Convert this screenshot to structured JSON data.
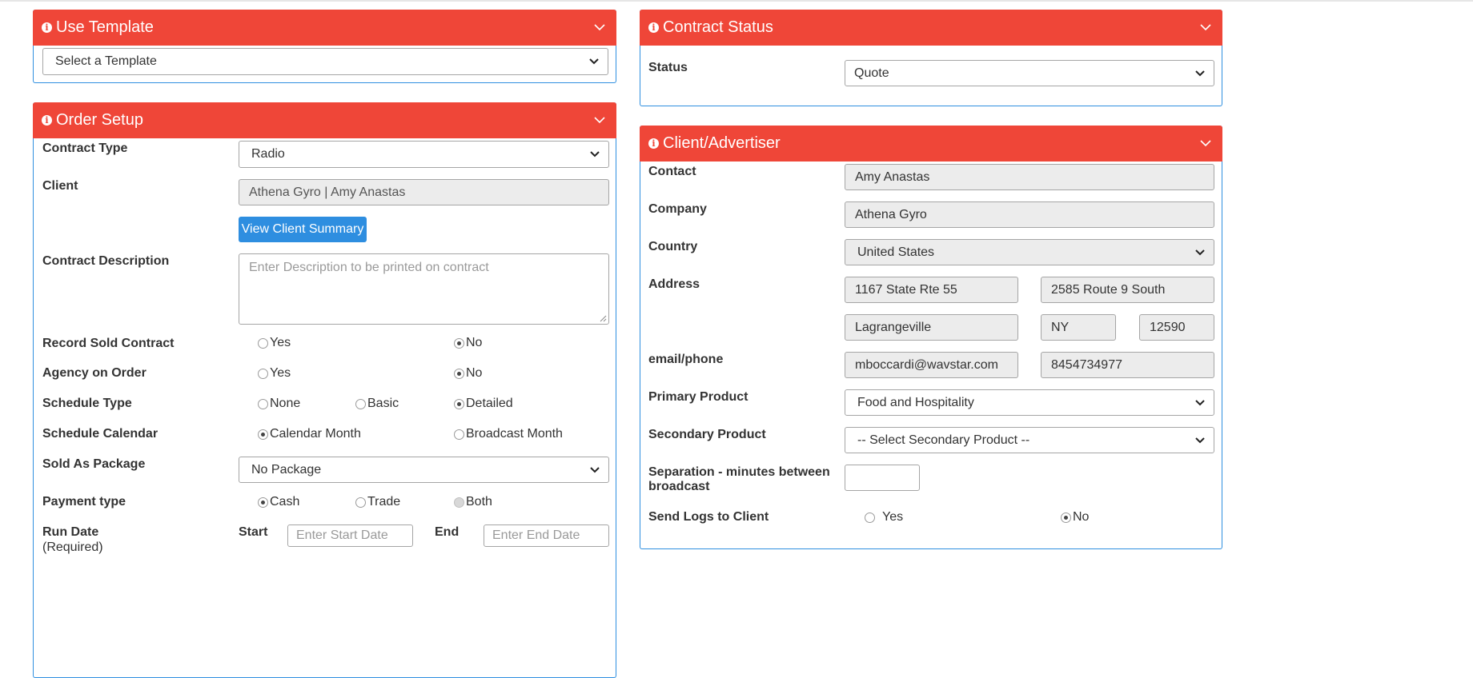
{
  "template_panel": {
    "title": "Use Template",
    "select_value": "Select a Template"
  },
  "order_setup": {
    "title": "Order Setup",
    "contract_type": {
      "label": "Contract Type",
      "value": "Radio"
    },
    "client": {
      "label": "Client",
      "value": "Athena Gyro | Amy Anastas",
      "button": "View Client Summary"
    },
    "contract_description": {
      "label": "Contract Description",
      "placeholder": "Enter Description to be printed on contract"
    },
    "record_sold_contract": {
      "label": "Record Sold Contract",
      "options": [
        "Yes",
        "No"
      ],
      "selected": "No"
    },
    "agency_on_order": {
      "label": "Agency on Order",
      "options": [
        "Yes",
        "No"
      ],
      "selected": "No"
    },
    "schedule_type": {
      "label": "Schedule Type",
      "options": [
        "None",
        "Basic",
        "Detailed"
      ],
      "selected": "Detailed"
    },
    "schedule_calendar": {
      "label": "Schedule Calendar",
      "options": [
        "Calendar Month",
        "Broadcast Month"
      ],
      "selected": "Calendar Month"
    },
    "sold_as_package": {
      "label": "Sold As Package",
      "value": "No Package"
    },
    "payment_type": {
      "label": "Payment type",
      "options": [
        "Cash",
        "Trade",
        "Both"
      ],
      "selected": "Cash",
      "disabled": "Both"
    },
    "run_date": {
      "label": "Run Date",
      "sublabel": "(Required)",
      "start_label": "Start",
      "start_placeholder": "Enter Start Date",
      "end_label": "End",
      "end_placeholder": "Enter End Date"
    }
  },
  "contract_status": {
    "title": "Contract Status",
    "status_label": "Status",
    "status_value": "Quote"
  },
  "client_advertiser": {
    "title": "Client/Advertiser",
    "contact": {
      "label": "Contact",
      "value": "Amy Anastas"
    },
    "company": {
      "label": "Company",
      "value": "Athena Gyro"
    },
    "country": {
      "label": "Country",
      "value": "United States"
    },
    "address": {
      "label": "Address",
      "line1": "1167 State Rte 55",
      "line2": "2585 Route 9 South",
      "city": "Lagrangeville",
      "state": "NY",
      "zip": "12590"
    },
    "email_phone": {
      "label": "email/phone",
      "email": "mboccardi@wavstar.com",
      "phone": "8454734977"
    },
    "primary_product": {
      "label": "Primary Product",
      "value": "Food and Hospitality"
    },
    "secondary_product": {
      "label": "Secondary Product",
      "value": "-- Select Secondary Product --"
    },
    "separation": {
      "label_line1": "Separation - minutes between",
      "label_line2": "broadcast",
      "value": ""
    },
    "send_logs": {
      "label": "Send Logs to Client",
      "options": [
        "Yes",
        "No"
      ],
      "selected": "No"
    }
  },
  "colors": {
    "panel_header": "#ef4638",
    "panel_border": "#2f8fe0",
    "button": "#2e8ee0",
    "readonly_field": "#ececec"
  },
  "icons": {
    "panel_info": "info-icon",
    "panel_collapse": "chevron-down-icon",
    "select_arrow": "chevron-down-icon"
  }
}
